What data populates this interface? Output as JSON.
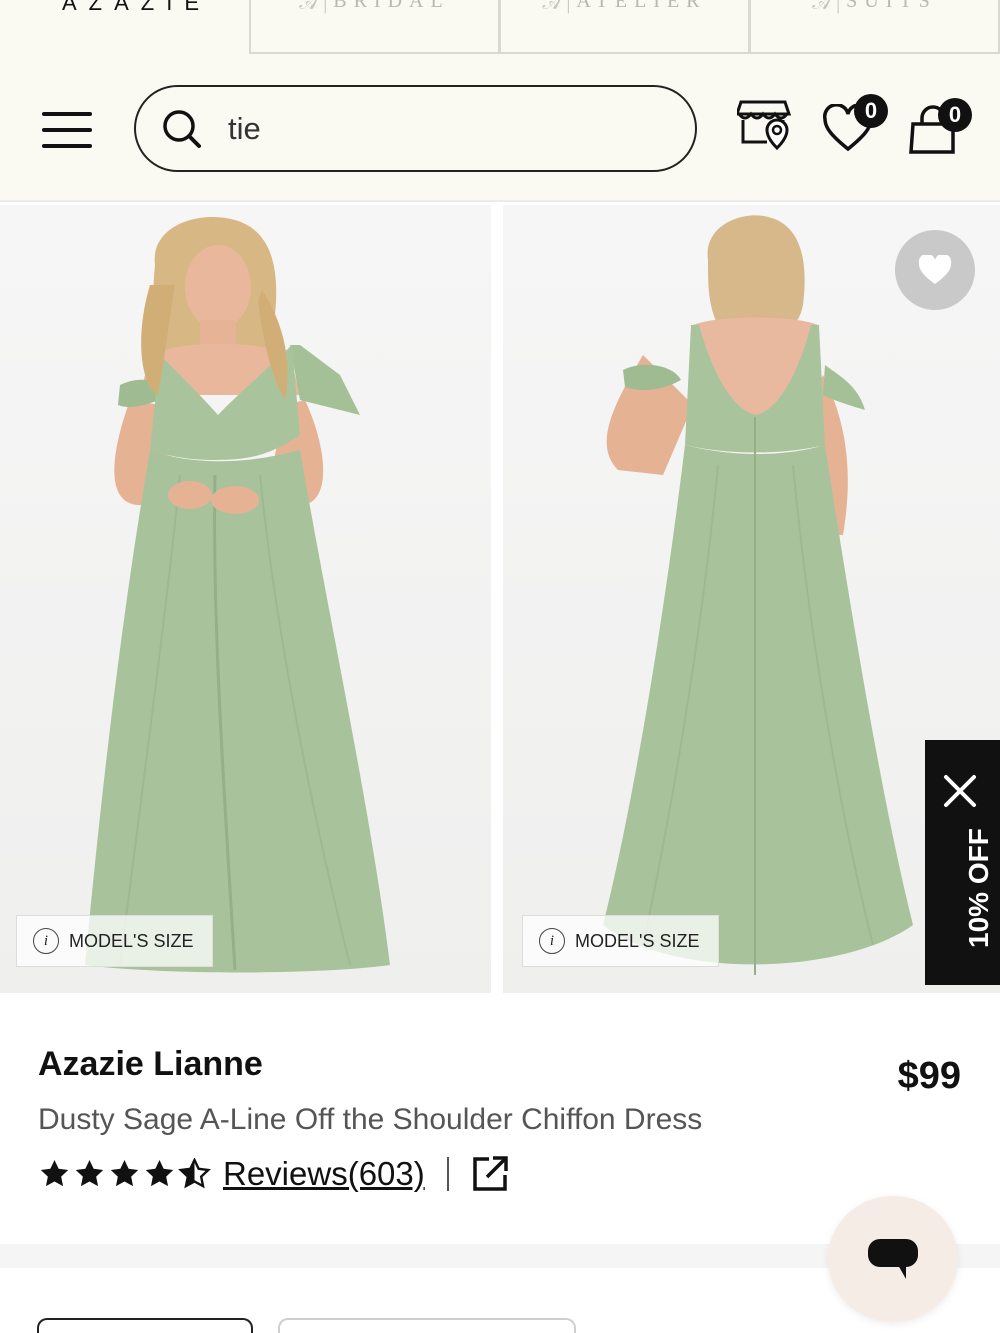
{
  "brand": {
    "logo": "AZAZIE",
    "tabs": [
      {
        "label": "BRIDAL"
      },
      {
        "label": "ATELIER"
      },
      {
        "label": "SUITS"
      }
    ]
  },
  "header": {
    "search": {
      "value": "tie",
      "placeholder": ""
    },
    "wishlist_count": "0",
    "cart_count": "0"
  },
  "gallery": {
    "images": [
      {
        "alt": "Model front view in Dusty Sage dress",
        "model_size_label": "MODEL'S SIZE"
      },
      {
        "alt": "Model back view in Dusty Sage dress",
        "model_size_label": "MODEL'S SIZE"
      }
    ],
    "dress_color": "#a9c49c"
  },
  "promo": {
    "text": "10% OFF"
  },
  "product": {
    "name": "Azazie Lianne",
    "price": "$99",
    "description": "Dusty Sage A-Line Off the Shoulder Chiffon Dress",
    "rating": 4.5,
    "reviews_label": "Reviews(603)"
  },
  "icons": {
    "menu": "hamburger-icon",
    "search": "search-icon",
    "store": "store-locator-icon",
    "wishlist": "heart-icon",
    "cart": "shopping-bag-icon",
    "favorite": "heart-icon",
    "info": "info-icon",
    "close": "close-icon",
    "share": "external-link-icon",
    "chat": "chat-icon"
  }
}
